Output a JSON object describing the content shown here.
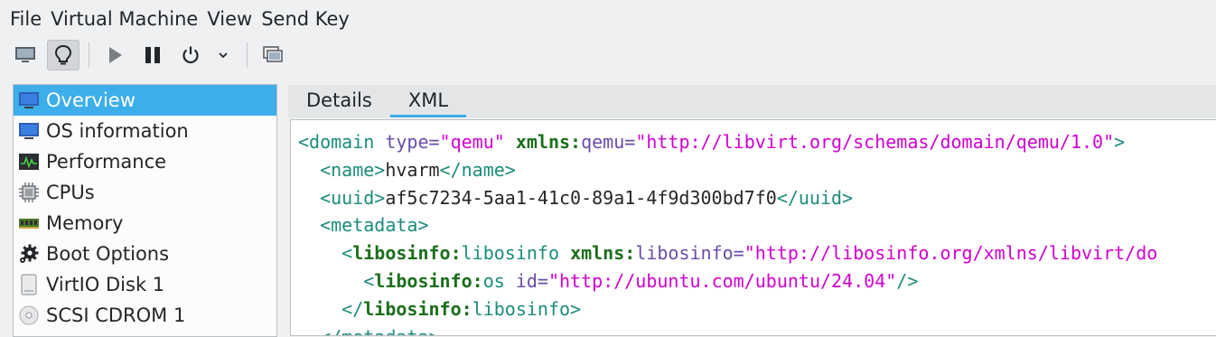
{
  "menubar": {
    "items": [
      "File",
      "Virtual Machine",
      "View",
      "Send Key"
    ]
  },
  "toolbar": {
    "buttons": [
      {
        "name": "console-button",
        "icon": "monitor-icon",
        "active": false
      },
      {
        "name": "details-button",
        "icon": "lightbulb-icon",
        "active": true
      },
      {
        "name": "run-button",
        "icon": "play-icon",
        "active": false
      },
      {
        "name": "pause-button",
        "icon": "pause-icon",
        "active": false
      },
      {
        "name": "shutdown-button",
        "icon": "power-icon",
        "active": false
      },
      {
        "name": "shutdown-menu-button",
        "icon": "chevron-down-icon",
        "active": false
      },
      {
        "name": "snapshots-button",
        "icon": "snapshots-icon",
        "active": false
      }
    ]
  },
  "sidebar": {
    "items": [
      {
        "label": "Overview",
        "icon": "monitor-icon",
        "selected": true
      },
      {
        "label": "OS information",
        "icon": "monitor-icon",
        "selected": false
      },
      {
        "label": "Performance",
        "icon": "graph-icon",
        "selected": false
      },
      {
        "label": "CPUs",
        "icon": "cpu-icon",
        "selected": false
      },
      {
        "label": "Memory",
        "icon": "memory-icon",
        "selected": false
      },
      {
        "label": "Boot Options",
        "icon": "gear-icon",
        "selected": false
      },
      {
        "label": "VirtIO Disk 1",
        "icon": "disk-icon",
        "selected": false
      },
      {
        "label": "SCSI CDROM 1",
        "icon": "cdrom-icon",
        "selected": false
      }
    ]
  },
  "tabs": {
    "items": [
      {
        "label": "Details",
        "active": false
      },
      {
        "label": "XML",
        "active": true
      }
    ]
  },
  "xml": {
    "lines": [
      [
        [
          "tg",
          "<domain "
        ],
        [
          "at",
          "type="
        ],
        [
          "st",
          "\"qemu\""
        ],
        [
          "tx",
          " "
        ],
        [
          "ns",
          "xmlns:"
        ],
        [
          "at",
          "qemu="
        ],
        [
          "st",
          "\"http://libvirt.org/schemas/domain/qemu/1.0\""
        ],
        [
          "tg",
          ">"
        ]
      ],
      [
        [
          "tg",
          "  <name>"
        ],
        [
          "tx",
          "hvarm"
        ],
        [
          "tg",
          "</name>"
        ]
      ],
      [
        [
          "tg",
          "  <uuid>"
        ],
        [
          "tx",
          "af5c7234-5aa1-41c0-89a1-4f9d300bd7f0"
        ],
        [
          "tg",
          "</uuid>"
        ]
      ],
      [
        [
          "tg",
          "  <metadata>"
        ]
      ],
      [
        [
          "tg",
          "    <"
        ],
        [
          "ns",
          "libosinfo:"
        ],
        [
          "tg",
          "libosinfo "
        ],
        [
          "ns",
          "xmlns:"
        ],
        [
          "at",
          "libosinfo="
        ],
        [
          "st",
          "\"http://libosinfo.org/xmlns/libvirt/do"
        ]
      ],
      [
        [
          "tg",
          "      <"
        ],
        [
          "ns",
          "libosinfo:"
        ],
        [
          "tg",
          "os "
        ],
        [
          "at",
          "id="
        ],
        [
          "st",
          "\"http://ubuntu.com/ubuntu/24.04\""
        ],
        [
          "tg",
          "/>"
        ]
      ],
      [
        [
          "tg",
          "    </"
        ],
        [
          "ns",
          "libosinfo:"
        ],
        [
          "tg",
          "libosinfo>"
        ]
      ],
      [
        [
          "tg",
          "  </metadata>"
        ]
      ]
    ]
  },
  "colors": {
    "accent": "#3daee9",
    "tag": "#1b8c7a",
    "attr": "#6a4ca8",
    "string": "#d000d0",
    "namespace": "#1b6e1b"
  }
}
